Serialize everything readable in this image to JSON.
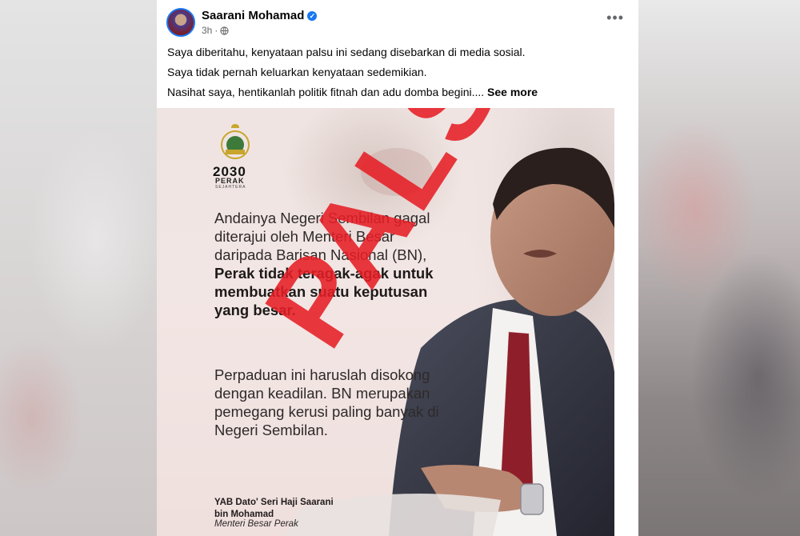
{
  "post": {
    "author": "Saarani Mohamad",
    "time": "3h",
    "visibility_icon": "globe-icon",
    "more_icon": "more-options-icon",
    "paragraphs": [
      "Saya diberitahu, kenyataan palsu ini sedang disebarkan di media sosial.",
      "Saya tidak pernah keluarkan kenyataan sedemikian.",
      "Nasihat saya, hentikanlah politik fitnah dan adu domba begini...."
    ],
    "see_more": "See more"
  },
  "image": {
    "logo_year": "2030",
    "logo_name": "PERAK",
    "logo_tagline": "SEJAHTERA",
    "quote_normal": "Andainya Negeri Sembilan gagal diterajui oleh Menteri Besar daripada Barisan Nasional (BN),",
    "quote_bold": "Perak tidak teragak-agak untuk membuatkan suatu keputusan yang besar.",
    "quote_2": "Perpaduan ini haruslah disokong dengan keadilan. BN merupakan pemegang kerusi paling banyak di Negeri Sembilan.",
    "signature_name": "YAB Dato' Seri Haji Saarani bin Mohamad",
    "signature_title": "Menteri Besar Perak",
    "stamp": "PALSU",
    "stamp_color": "#e61e26"
  },
  "colors": {
    "verified": "#1877f2",
    "text": "#050505",
    "meta": "#65676b"
  }
}
